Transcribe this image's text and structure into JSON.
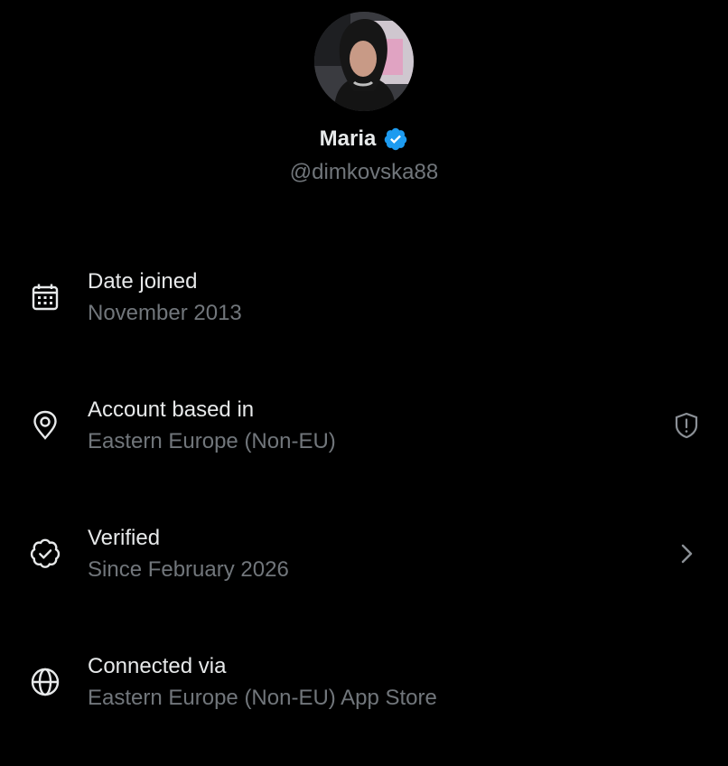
{
  "profile": {
    "display_name": "Maria",
    "handle": "@dimkovska88",
    "verified": true,
    "badge_color": "#1d9bf0"
  },
  "info_rows": [
    {
      "icon": "calendar-icon",
      "title": "Date joined",
      "value": "November 2013"
    },
    {
      "icon": "location-pin-icon",
      "title": "Account based in",
      "value": "Eastern Europe (Non-EU)",
      "action_icon": "shield-alert-icon"
    },
    {
      "icon": "verified-badge-icon",
      "title": "Verified",
      "value": "Since February 2026",
      "action_icon": "chevron-right-icon"
    },
    {
      "icon": "globe-icon",
      "title": "Connected via",
      "value": "Eastern Europe (Non-EU) App Store"
    }
  ],
  "colors": {
    "background": "#000000",
    "primary_text": "#e7e9ea",
    "secondary_text": "#71767b",
    "accent": "#1d9bf0"
  }
}
